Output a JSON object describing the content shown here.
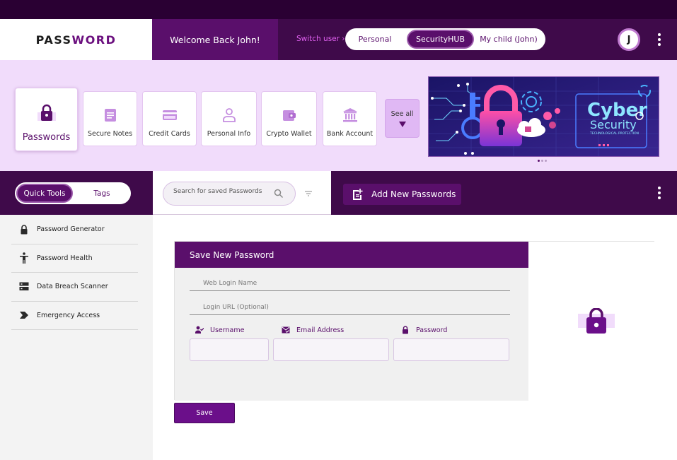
{
  "brand": {
    "logo_main": "PASS",
    "logo_accent": "WORD"
  },
  "header": {
    "welcome": "Welcome Back John!",
    "switch_label": "Switch user ›",
    "profiles": [
      "Personal",
      "SecurityHUB",
      "My child (John)"
    ],
    "active_profile": "SecurityHUB",
    "avatar_initial": "J"
  },
  "categories": {
    "tiles": [
      {
        "label": "Passwords",
        "icon": "lock-icon",
        "selected": true
      },
      {
        "label": "Secure Notes",
        "icon": "note-icon"
      },
      {
        "label": "Credit Cards",
        "icon": "credit-card-icon"
      },
      {
        "label": "Personal Info",
        "icon": "person-icon"
      },
      {
        "label": "Crypto Wallet",
        "icon": "wallet-icon"
      },
      {
        "label": "Bank Account",
        "icon": "bank-icon"
      }
    ],
    "see_all": "See all"
  },
  "banner": {
    "title_line1": "Cyber",
    "title_line2": "Security",
    "tagline": "TECHNOLOGICAL PROTECTION",
    "slides": 3,
    "active_slide": 1
  },
  "sidebar": {
    "toggle": [
      "Quick Tools",
      "Tags"
    ],
    "active_toggle": "Quick Tools",
    "tools": [
      {
        "label": "Password Generator",
        "icon": "lock-icon"
      },
      {
        "label": "Password Health",
        "icon": "person-standing-icon"
      },
      {
        "label": "Data Breach Scanner",
        "icon": "server-icon"
      },
      {
        "label": "Emergency Access",
        "icon": "arrow-chevron-icon"
      }
    ]
  },
  "search": {
    "placeholder": "Search for saved Passwords"
  },
  "actions": {
    "add_new": "Add New Passwords"
  },
  "form": {
    "title": "Save New Password",
    "web_login_placeholder": "Web Login Name",
    "login_url_placeholder": "Login URL (Optional)",
    "username_label": "Username",
    "email_label": "Email Address",
    "password_label": "Password",
    "save_label": "Save"
  },
  "colors": {
    "dark": "#3f0a4a",
    "primary": "#5a0f6b",
    "light": "#f1dcfb",
    "accent": "#e060f0"
  }
}
